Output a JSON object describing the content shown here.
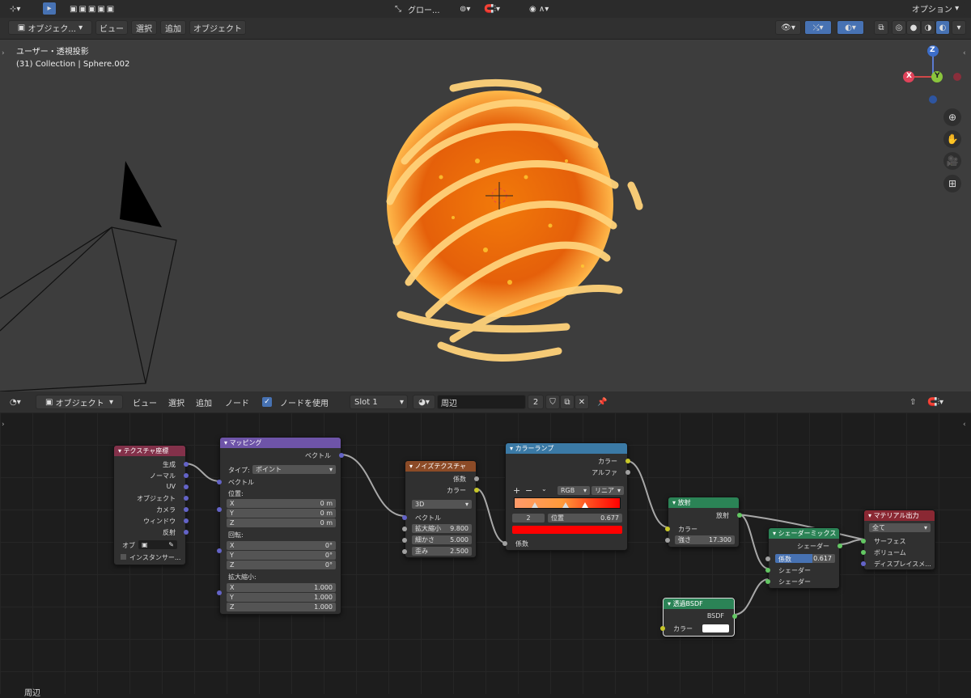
{
  "topbar": {
    "orientation_label": "グロー...",
    "options_label": "オプション"
  },
  "viewport_header": {
    "mode_label": "オブジェク...",
    "menu": [
      "ビュー",
      "選択",
      "追加",
      "オブジェクト"
    ]
  },
  "viewport": {
    "view_name": "ユーザー・透視投影",
    "object_info": "(31) Collection | Sphere.002",
    "gizmo": {
      "x": "X",
      "y": "Y",
      "z": "Z"
    }
  },
  "node_header": {
    "type_label": "オブジェクト",
    "menu": [
      "ビュー",
      "選択",
      "追加",
      "ノード"
    ],
    "use_nodes_label": "ノードを使用",
    "slot_label": "Slot 1",
    "material_name": "周辺",
    "users_count": "2"
  },
  "node_footer": {
    "material_label": "周辺"
  },
  "nodes": {
    "texcoord": {
      "title": "テクスチャ座標",
      "outputs": [
        "生成",
        "ノーマル",
        "UV",
        "オブジェクト",
        "カメラ",
        "ウィンドウ",
        "反射"
      ],
      "object_label": "オブ",
      "instancer_label": "インスタンサー..."
    },
    "mapping": {
      "title": "マッピング",
      "output": "ベクトル",
      "type_label": "タイプ:",
      "type_value": "ポイント",
      "vector_label": "ベクトル",
      "location_label": "位置:",
      "location": [
        {
          "axis": "X",
          "value": "0 m"
        },
        {
          "axis": "Y",
          "value": "0 m"
        },
        {
          "axis": "Z",
          "value": "0 m"
        }
      ],
      "rotation_label": "回転:",
      "rotation": [
        {
          "axis": "X",
          "value": "0°"
        },
        {
          "axis": "Y",
          "value": "0°"
        },
        {
          "axis": "Z",
          "value": "0°"
        }
      ],
      "scale_label": "拡大縮小:",
      "scale": [
        {
          "axis": "X",
          "value": "1.000"
        },
        {
          "axis": "Y",
          "value": "1.000"
        },
        {
          "axis": "Z",
          "value": "1.000"
        }
      ]
    },
    "noise": {
      "title": "ノイズテクスチャ",
      "outputs": [
        "係数",
        "カラー"
      ],
      "dim_value": "3D",
      "vector_label": "ベクトル",
      "fields": [
        {
          "label": "拡大縮小",
          "value": "9.800"
        },
        {
          "label": "細かさ",
          "value": "5.000"
        },
        {
          "label": "歪み",
          "value": "2.500"
        }
      ]
    },
    "colorramp": {
      "title": "カラーランプ",
      "outputs": [
        "カラー",
        "アルファ"
      ],
      "color_mode": "RGB",
      "interpolation": "リニア",
      "active_index": "2",
      "position_label": "位置",
      "position_value": "0.677",
      "input_label": "係数",
      "active_color": "#ff0000",
      "ramp_start": "#ff9a6a",
      "ramp_end": "#ff0000"
    },
    "emission": {
      "title": "放射",
      "output": "放射",
      "color_label": "カラー",
      "strength_label": "強さ",
      "strength_value": "17.300"
    },
    "mixshader": {
      "title": "シェーダーミックス",
      "output": "シェーダー",
      "fac_label": "係数",
      "fac_value": "0.617",
      "inputs": [
        "シェーダー",
        "シェーダー"
      ]
    },
    "transparent": {
      "title": "透過BSDF",
      "output": "BSDF",
      "color_label": "カラー"
    },
    "output": {
      "title": "マテリアル出力",
      "target_value": "全て",
      "inputs": [
        "サーフェス",
        "ボリューム",
        "ディスプレイスメ..."
      ]
    }
  },
  "colors": {
    "texture_header": "#83314a",
    "vector_header": "#6e54a8",
    "noise_header": "#8c4b27",
    "converter_header": "#3b7aa6",
    "shader_header": "#2b8356",
    "output_header": "#8a2833"
  }
}
